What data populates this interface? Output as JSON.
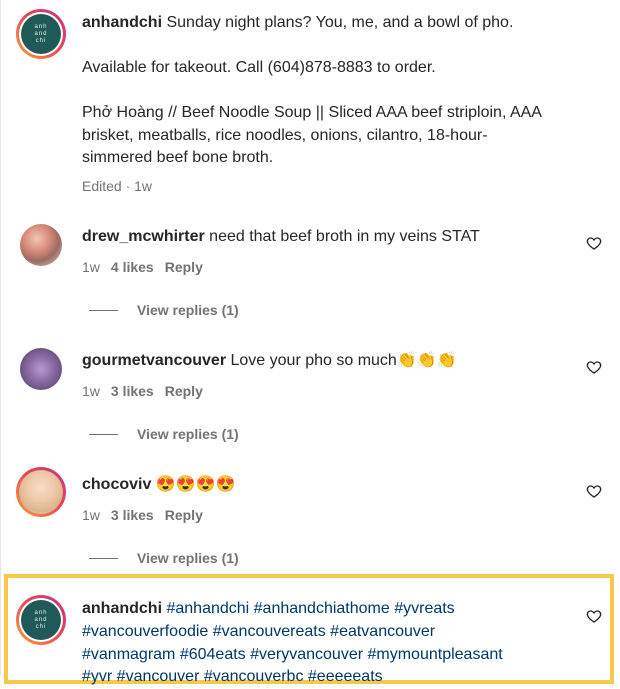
{
  "caption": {
    "username": "anhandchi",
    "line1": "Sunday night plans? You, me, and a bowl of pho.",
    "line2": "Available for takeout. Call (604)878-8883 to order.",
    "line3": "Phở Hoàng // Beef Noodle Soup || Sliced AAA beef striploin, AAA brisket, meatballs, rice noodles, onions, cilantro, 18-hour-simmered beef bone broth.",
    "meta": "Edited · 1w",
    "logo_text": [
      "anh",
      "and",
      "chi"
    ]
  },
  "comments": [
    {
      "username": "drew_mcwhirter",
      "text": "need that beef broth in my veins STAT",
      "age": "1w",
      "likes": "4 likes",
      "reply": "Reply",
      "view_replies": "View replies (1)"
    },
    {
      "username": "gourmetvancouver",
      "text": "Love your pho so much👏👏👏",
      "age": "1w",
      "likes": "3 likes",
      "reply": "Reply",
      "view_replies": "View replies (1)"
    },
    {
      "username": "chocoviv",
      "text": "😍😍😍😍",
      "age": "1w",
      "likes": "3 likes",
      "reply": "Reply",
      "view_replies": "View replies (1)"
    }
  ],
  "hashtag_post": {
    "username": "anhandchi",
    "line1": "#anhandchi #anhandchiathome #yvreats",
    "line2": "#vancouverfoodie #vancouvereats #eatvancouver",
    "line3": "#vanmagram #604eats #veryvancouver #mymountpleasant",
    "line4": "#yvr #vancouver #vancouverbc #eeeeeats"
  },
  "colors": {
    "highlight": "#f7c948",
    "hashtag": "#00376b",
    "muted": "#737373"
  }
}
